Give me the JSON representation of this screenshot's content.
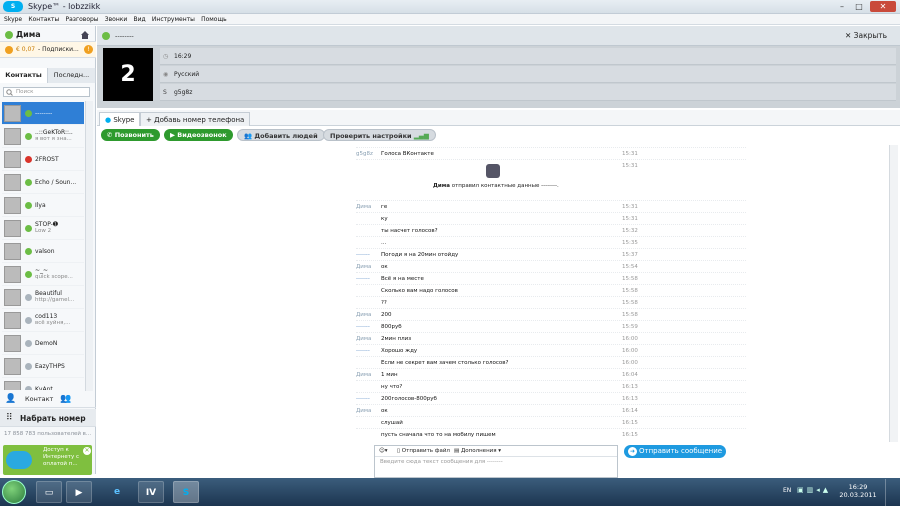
{
  "window": {
    "logo": "S",
    "title": "Skype™ - lobzzikk",
    "minimize": "–",
    "maximize": "□",
    "close": "✕"
  },
  "menu": [
    "Skype",
    "Контакты",
    "Разговоры",
    "Звонки",
    "Вид",
    "Инструменты",
    "Помощь"
  ],
  "user": {
    "name": "Дима",
    "home_icon": "house-icon"
  },
  "credit": {
    "amount": "€ 0,07",
    "label": "- Подписки..."
  },
  "tabs": {
    "contacts": "Контакты",
    "recent": "Последн..."
  },
  "search": {
    "placeholder": "Поиск"
  },
  "contacts": [
    {
      "name": "--------",
      "sub": "",
      "status": "online",
      "selected": true
    },
    {
      "name": "..::GeKToR::..",
      "sub": "я вот я зна...",
      "status": "online"
    },
    {
      "name": "2FROST",
      "sub": "",
      "status": "busy"
    },
    {
      "name": "Echo / Soun...",
      "sub": "",
      "status": "online"
    },
    {
      "name": "Ilya",
      "sub": "",
      "status": "online"
    },
    {
      "name": "STOP-➊",
      "sub": "Low 2",
      "status": "online"
    },
    {
      "name": "valson",
      "sub": "",
      "status": "online"
    },
    {
      "name": "~_~",
      "sub": "quick scope...",
      "status": "online"
    },
    {
      "name": "Beautiful",
      "sub": "http://gamel...",
      "status": "offline"
    },
    {
      "name": "cod113",
      "sub": "всё хуйня,...",
      "status": "offline"
    },
    {
      "name": "DemoN",
      "sub": "",
      "status": "offline"
    },
    {
      "name": "EazyTHPS",
      "sub": "",
      "status": "offline"
    },
    {
      "name": "KvAnt",
      "sub": "",
      "status": "offline"
    }
  ],
  "left_bottom": {
    "add_contact": "Контакт",
    "dial": "Набрать номер",
    "users_online": "17 858 783 пользователей в...",
    "promo": "Доступ к Интернету с оплатой п..."
  },
  "header": {
    "name": "--------",
    "close": "Закрыть"
  },
  "profile": {
    "avatar_text": "2",
    "time": "16:29",
    "language": "Русский",
    "skype_name": "g5g8z"
  },
  "convo_tabs": {
    "skype": "Skype",
    "add_phone": "Добавь номер телефона"
  },
  "actions": {
    "call": "Позвонить",
    "video": "Видеозвонок",
    "add_people": "Добавить людей",
    "check_settings": "Проверить настройки"
  },
  "messages": [
    {
      "who": "g5g8z",
      "text": "Голоса ВКонтакте",
      "time": "15:31"
    },
    {
      "who": "",
      "text": "",
      "time": "15:31"
    },
    {
      "who": "Дима",
      "text": "ге",
      "time": "15:31"
    },
    {
      "who": "",
      "text": "ку",
      "time": "15:31"
    },
    {
      "who": "",
      "text": "ты насчет голосов?",
      "time": "15:32"
    },
    {
      "who": "",
      "text": "...",
      "time": "15:35"
    },
    {
      "who": "-------",
      "text": "Погоди я на 20мин отойду",
      "time": "15:37"
    },
    {
      "who": "Дима",
      "text": "ок",
      "time": "15:54"
    },
    {
      "who": "-------",
      "text": "Всё я на месте",
      "time": "15:58"
    },
    {
      "who": "",
      "text": "Сколько вам надо голосов",
      "time": "15:58"
    },
    {
      "who": "",
      "text": "??",
      "time": "15:58"
    },
    {
      "who": "Дима",
      "text": "200",
      "time": "15:58"
    },
    {
      "who": "-------",
      "text": "800руб",
      "time": "15:59"
    },
    {
      "who": "Дима",
      "text": "2мин плиз",
      "time": "16:00"
    },
    {
      "who": "-------",
      "text": "Хорошо жду",
      "time": "16:00"
    },
    {
      "who": "",
      "text": "Если не секрет вам зачем столько голосов?",
      "time": "16:00"
    },
    {
      "who": "Дима",
      "text": "1 мин",
      "time": "16:04"
    },
    {
      "who": "",
      "text": "ну что?",
      "time": "16:13"
    },
    {
      "who": "-------",
      "text": "200голосов-800руб",
      "time": "16:13"
    },
    {
      "who": "Дима",
      "text": "ок",
      "time": "16:14"
    },
    {
      "who": "",
      "text": "слушай",
      "time": "16:15"
    },
    {
      "who": "",
      "text": "пусть сначала что то на мобилу пишем",
      "time": "16:15"
    }
  ],
  "contact_notice": {
    "sender": "Дима",
    "text": "отправил контактные данные --------."
  },
  "composer": {
    "send_file": "Отправить файл",
    "extras": "Дополнения",
    "placeholder": "Введите сюда текст сообщения для --------",
    "send_button": "Отправить сообщение"
  },
  "taskbar": {
    "time": "16:29",
    "date": "20.03.2011",
    "lang": "EN"
  }
}
